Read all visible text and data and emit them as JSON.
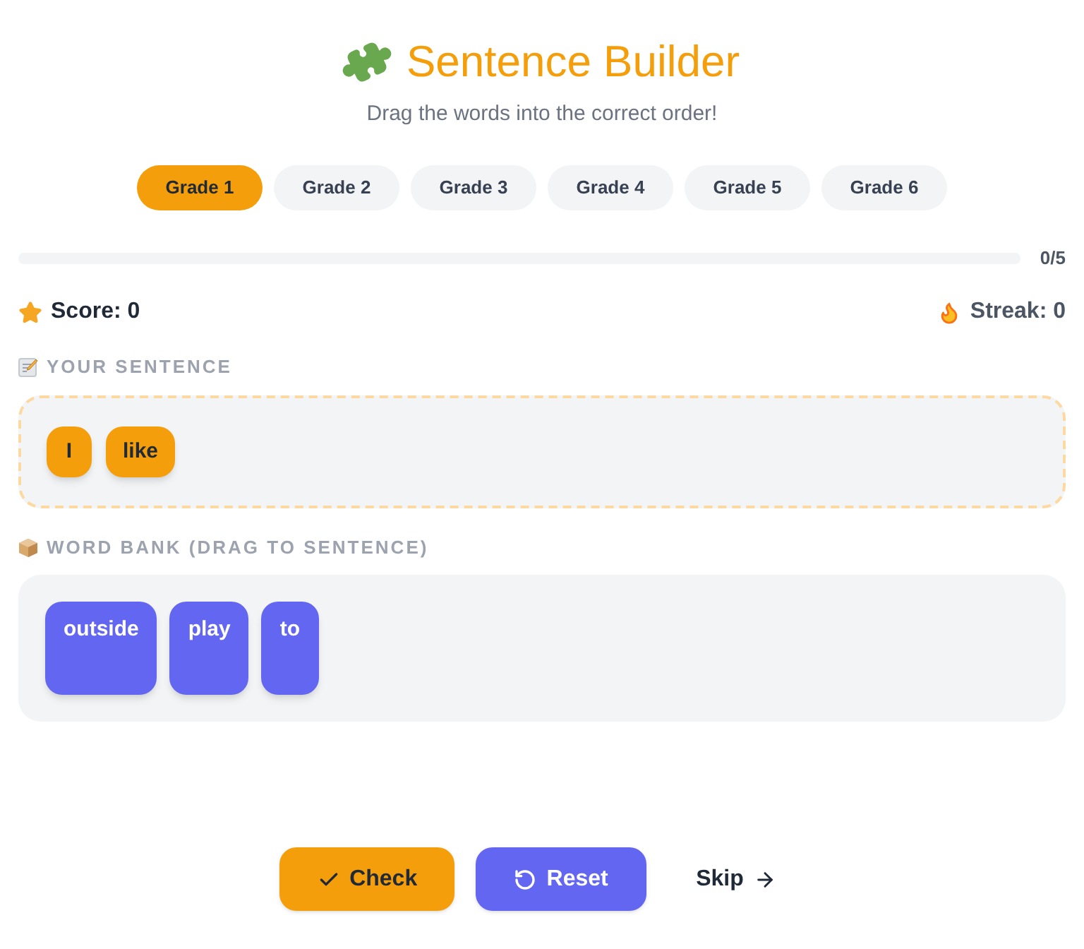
{
  "header": {
    "title": "Sentence Builder",
    "subtitle": "Drag the words into the correct order!"
  },
  "grades": [
    {
      "label": "Grade 1",
      "selected": true
    },
    {
      "label": "Grade 2",
      "selected": false
    },
    {
      "label": "Grade 3",
      "selected": false
    },
    {
      "label": "Grade 4",
      "selected": false
    },
    {
      "label": "Grade 5",
      "selected": false
    },
    {
      "label": "Grade 6",
      "selected": false
    }
  ],
  "progress": {
    "level": 0,
    "reading": "0/5"
  },
  "stats": {
    "score": "Score: 0",
    "streak": "Streak: 0"
  },
  "sentence": {
    "label": "YOUR SENTENCE",
    "words": [
      "I",
      "like"
    ]
  },
  "word_bank": {
    "label": "WORD BANK (DRAG TO SENTENCE)",
    "words": [
      "outside",
      "play",
      "to"
    ]
  },
  "buttons": [
    {
      "kind": "check",
      "label": "Check"
    },
    {
      "kind": "reset",
      "label": "Reset"
    },
    {
      "kind": "skip",
      "label": "Skip"
    }
  ]
}
